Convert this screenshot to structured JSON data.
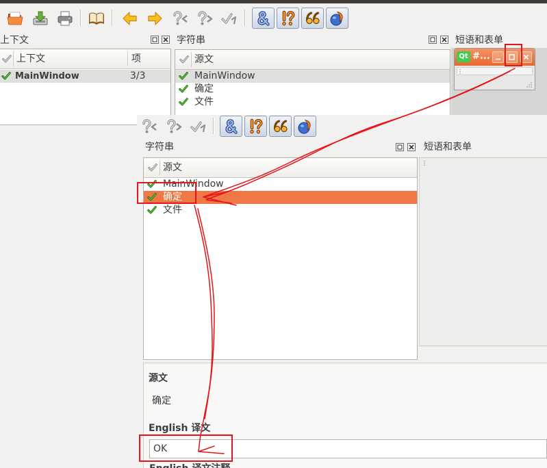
{
  "main_toolbar": {
    "icons": [
      "open-icon",
      "save-icon",
      "print-icon",
      "phrasebook-icon",
      "previous-icon",
      "next-icon",
      "previous-unfinished-icon",
      "next-unfinished-icon",
      "done-and-next-icon",
      "accelerators-check-icon",
      "punctuation-check-icon",
      "phrase-matches-check-icon",
      "place-markers-check-icon"
    ],
    "pressed": [
      "accelerators-check-icon",
      "punctuation-check-icon",
      "phrase-matches-check-icon",
      "place-markers-check-icon"
    ]
  },
  "context_dock": {
    "title": "上下文",
    "columns": {
      "context": "上下文",
      "items": "项"
    },
    "rows": [
      {
        "icon": "done-check-icon",
        "context": "MainWindow",
        "items": "3/3",
        "selected": true
      }
    ]
  },
  "strings_dock": {
    "title": "字符串",
    "columns": {
      "source": "源文"
    },
    "rows": [
      {
        "icon": "done-check-icon",
        "source": "MainWindow",
        "selected": true
      },
      {
        "icon": "done-check-icon",
        "source": "确定"
      },
      {
        "icon": "done-check-icon",
        "source": "文件"
      }
    ]
  },
  "phrases_dock": {
    "title": "短语和表单",
    "floating_window": {
      "logo": "Qt",
      "title": "#...",
      "buttons": [
        "minimize-icon",
        "maximize-icon",
        "close-icon"
      ]
    }
  },
  "zoomed_view": {
    "toolbar": {
      "icons": [
        "previous-unfinished-icon",
        "next-unfinished-icon",
        "done-and-next-icon",
        "accelerators-check-icon",
        "punctuation-check-icon",
        "phrase-matches-check-icon",
        "place-markers-check-icon"
      ]
    },
    "strings_dock": {
      "title": "字符串",
      "columns": {
        "source": "源文"
      },
      "rows": [
        {
          "icon": "done-check-icon",
          "source": "MainWindow"
        },
        {
          "icon": "done-check-icon",
          "source": "确定",
          "selected": true
        },
        {
          "icon": "done-check-icon",
          "source": "文件"
        }
      ]
    },
    "phrases_dock": {
      "title": "短语和表单"
    },
    "translation_editor": {
      "source_label": "源文",
      "source_text": "确定",
      "translation_label": "English 译文",
      "translation_value": "OK",
      "comment_label": "English 译文注释"
    }
  },
  "annotations": {
    "color": "#e3151b"
  },
  "colors": {
    "window_bg": "#f2f1f0",
    "selection": "#f07746",
    "floating_title_bar": "#ee7a45",
    "done_check": "#5bc238",
    "qt_logo": "#41cd52"
  }
}
